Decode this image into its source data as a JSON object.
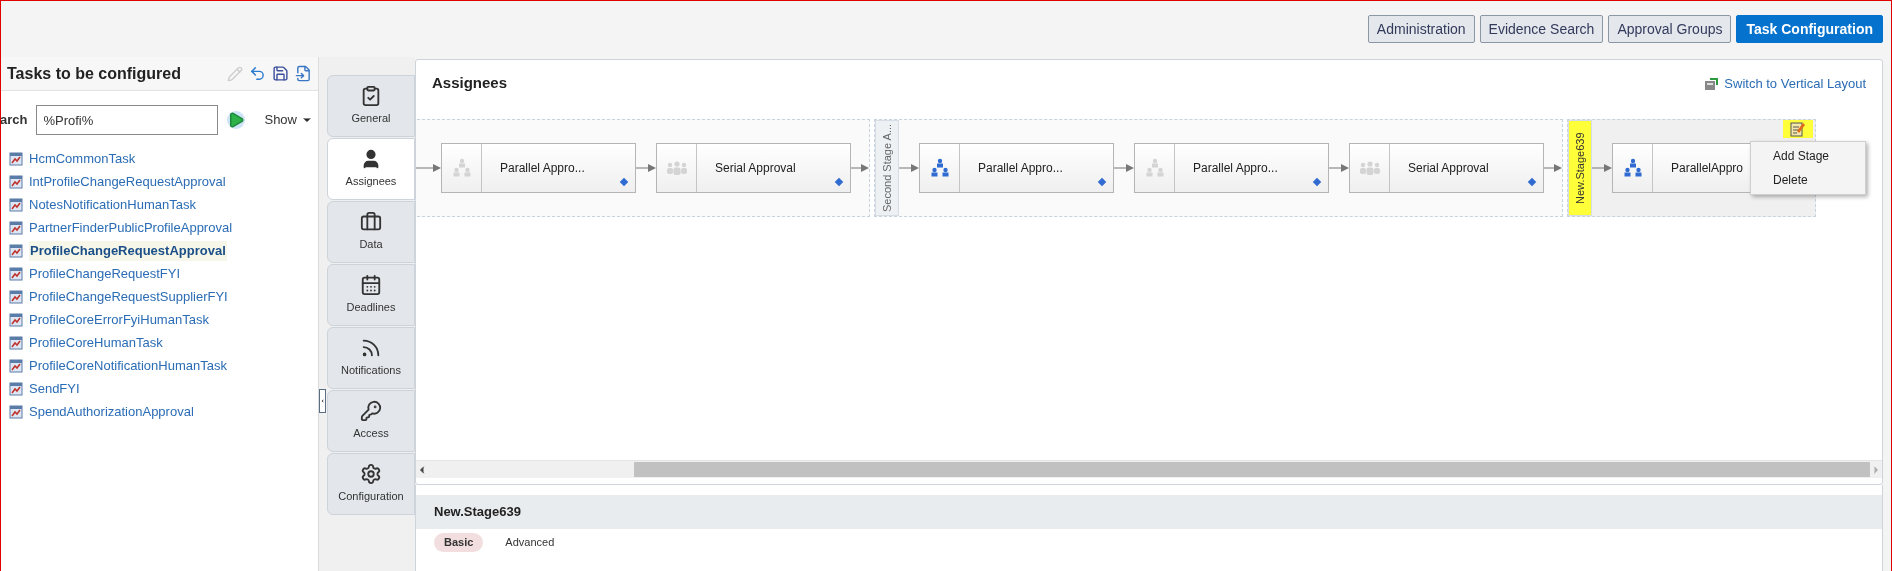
{
  "top_nav": [
    {
      "label": "Administration",
      "selected": false
    },
    {
      "label": "Evidence Search",
      "selected": false
    },
    {
      "label": "Approval Groups",
      "selected": false
    },
    {
      "label": "Task Configuration",
      "selected": true
    }
  ],
  "task_panel": {
    "title": "Tasks to be configured",
    "search_label": "arch",
    "search_value": "%Profi%",
    "show_label": "Show",
    "tasks": [
      {
        "label": "HcmCommonTask",
        "selected": false
      },
      {
        "label": "IntProfileChangeRequestApproval",
        "selected": false
      },
      {
        "label": "NotesNotificationHumanTask",
        "selected": false
      },
      {
        "label": "PartnerFinderPublicProfileApproval",
        "selected": false
      },
      {
        "label": "ProfileChangeRequestApproval",
        "selected": true
      },
      {
        "label": "ProfileChangeRequestFYI",
        "selected": false
      },
      {
        "label": "ProfileChangeRequestSupplierFYI",
        "selected": false
      },
      {
        "label": "ProfileCoreErrorFyiHumanTask",
        "selected": false
      },
      {
        "label": "ProfileCoreHumanTask",
        "selected": false
      },
      {
        "label": "ProfileCoreNotificationHumanTask",
        "selected": false
      },
      {
        "label": "SendFYI",
        "selected": false
      },
      {
        "label": "SpendAuthorizationApproval",
        "selected": false
      }
    ]
  },
  "side_tabs": [
    {
      "label": "General",
      "selected": false
    },
    {
      "label": "Assignees",
      "selected": true
    },
    {
      "label": "Data",
      "selected": false
    },
    {
      "label": "Deadlines",
      "selected": false
    },
    {
      "label": "Notifications",
      "selected": false
    },
    {
      "label": "Access",
      "selected": false
    },
    {
      "label": "Configuration",
      "selected": false
    }
  ],
  "assignees": {
    "title": "Assignees",
    "switch_link": "Switch to Vertical Layout",
    "stages": [
      {
        "nodes": [
          {
            "label": "Parallel Appro...",
            "kind": "parallel",
            "active": false
          },
          {
            "label": "Serial Approval",
            "kind": "serial",
            "active": false
          }
        ]
      },
      {
        "label": "Second Stage A...",
        "highlighted": false,
        "nodes": [
          {
            "label": "Parallel Appro...",
            "kind": "parallel",
            "active": true
          },
          {
            "label": "Parallel Appro...",
            "kind": "parallel",
            "active": false
          },
          {
            "label": "Serial Approval",
            "kind": "serial",
            "active": false
          }
        ]
      },
      {
        "label": "New.Stage639",
        "highlighted": true,
        "edit_highlighted": true,
        "nodes": [
          {
            "label": "ParallelAppro",
            "kind": "parallel",
            "active": true
          }
        ]
      }
    ],
    "context_menu": [
      "Add Stage",
      "Delete"
    ]
  },
  "details": {
    "title": "New.Stage639",
    "tabs": [
      {
        "label": "Basic",
        "selected": true
      },
      {
        "label": "Advanced",
        "selected": false
      }
    ]
  }
}
